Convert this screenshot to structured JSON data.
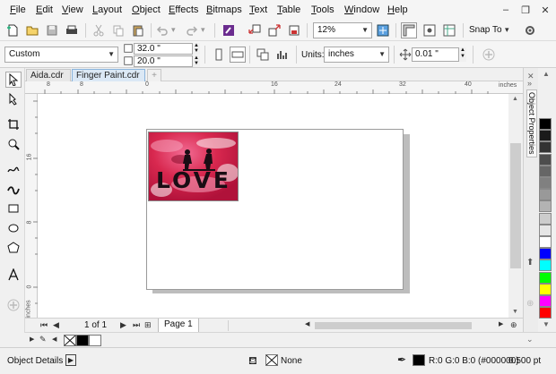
{
  "menu": [
    "File",
    "Edit",
    "View",
    "Layout",
    "Object",
    "Effects",
    "Bitmaps",
    "Text",
    "Table",
    "Tools",
    "Window",
    "Help"
  ],
  "toolbar": {
    "zoom_value": "12%",
    "snap_label": "Snap To"
  },
  "property_bar": {
    "page_preset": "Custom",
    "width_value": "32.0 \"",
    "height_value": "20.0 \"",
    "units_label": "Units:",
    "units_value": "inches",
    "nudge_value": "0.01 \""
  },
  "tabs": [
    "Aida.cdr",
    "Finger Paint.cdr"
  ],
  "active_tab": 1,
  "ruler": {
    "h_labels": [
      "8",
      "0",
      "8",
      "16",
      "24",
      "32",
      "40"
    ],
    "h_unit": "inches",
    "v_labels": [
      "16",
      "8",
      "0"
    ],
    "v_unit": "inches"
  },
  "image_text": "LOVE",
  "page_nav": {
    "page_count": "1 of 1",
    "page_tab": "Page 1"
  },
  "docker": {
    "title": "Object Properties"
  },
  "palette": {
    "colors": [
      "#000000",
      "#1a1a1a",
      "#333333",
      "#4d4d4d",
      "#666666",
      "#808080",
      "#999999",
      "#b3b3b3",
      "#cccccc",
      "#e6e6e6",
      "#ffffff",
      "#0000ff",
      "#00ffff",
      "#00ff00",
      "#ffff00",
      "#ff00ff",
      "#ff0000"
    ]
  },
  "status": {
    "object_details": "Object Details",
    "fill_label": "None",
    "outline_color": "R:0 G:0 B:0 (#000000)",
    "outline_width": "0.500 pt"
  }
}
